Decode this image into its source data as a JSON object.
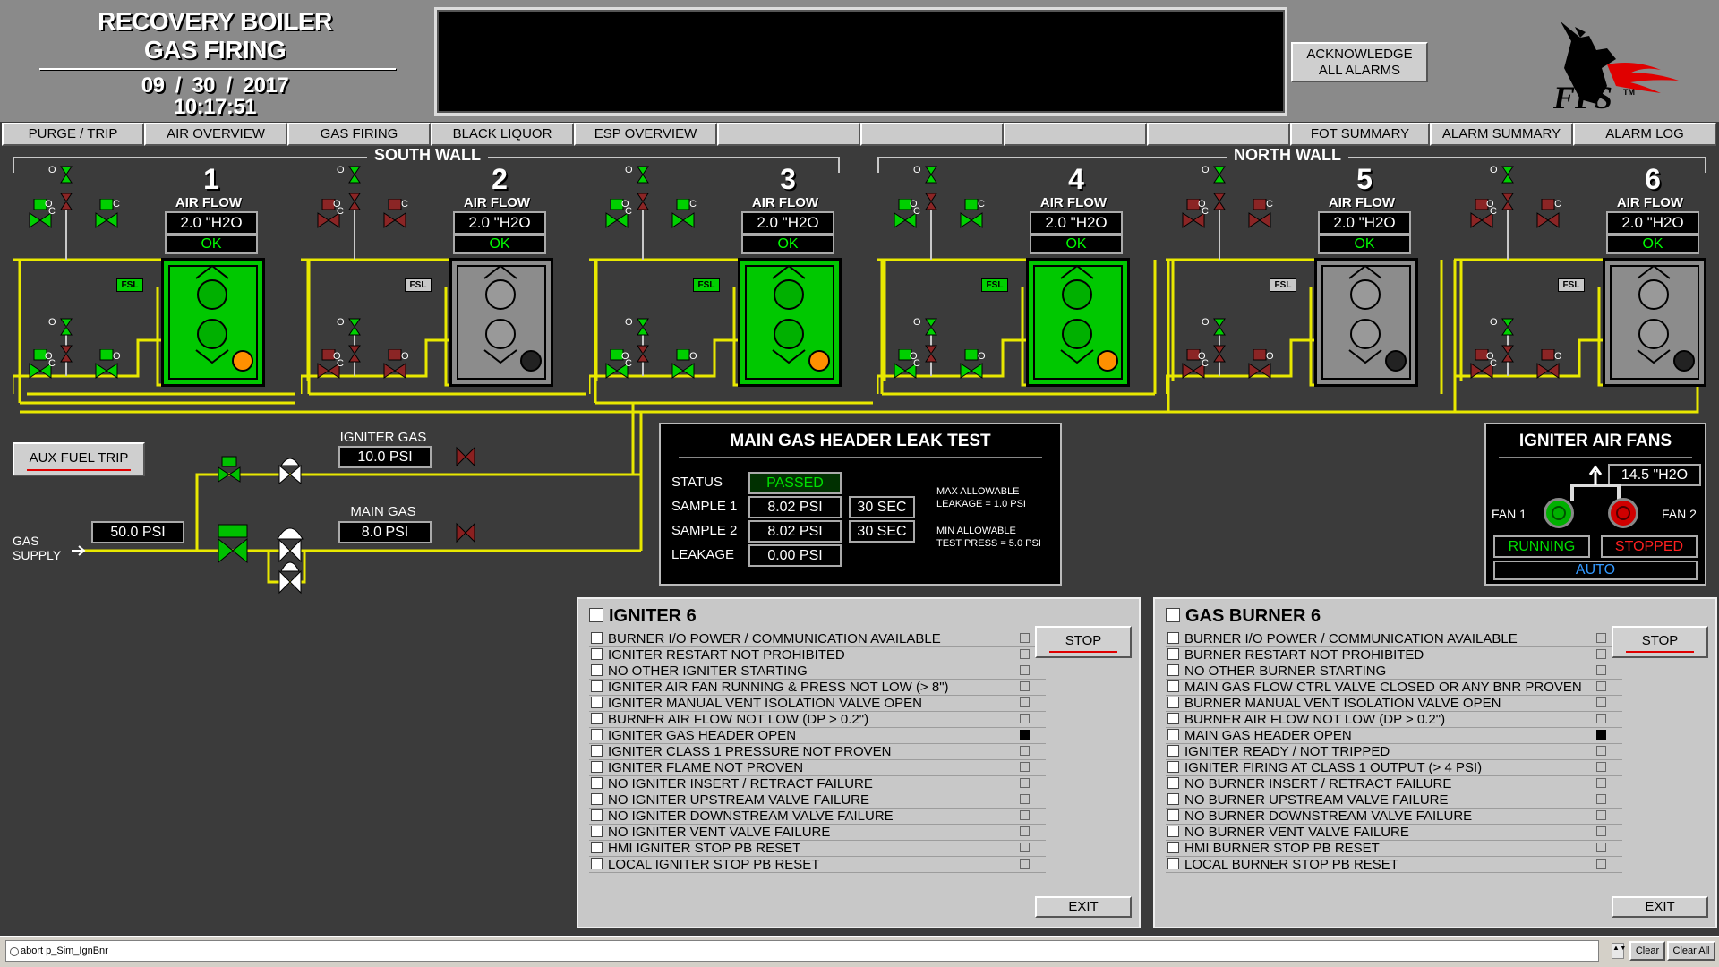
{
  "header": {
    "title_line1": "RECOVERY BOILER",
    "title_line2": "GAS FIRING",
    "date": "09  /  30  /  2017",
    "time": "10:17:51",
    "ack_label_1": "ACKNOWLEDGE",
    "ack_label_2": "ALL ALARMS",
    "logo_text": "FPS",
    "logo_tm": "TM"
  },
  "nav": {
    "purge_trip": "PURGE / TRIP",
    "air_overview": "AIR OVERVIEW",
    "gas_firing": "GAS FIRING",
    "black_liquor": "BLACK LIQUOR",
    "esp_overview": "ESP OVERVIEW",
    "fot_summary": "FOT SUMMARY",
    "alarm_summary": "ALARM SUMMARY",
    "alarm_log": "ALARM LOG"
  },
  "walls": {
    "south": "SOUTH WALL",
    "north": "NORTH WALL"
  },
  "burners": [
    {
      "num": "1",
      "air_label": "AIR FLOW",
      "air_value": "2.0 \"H2O",
      "status": "OK",
      "state": "running"
    },
    {
      "num": "2",
      "air_label": "AIR FLOW",
      "air_value": "2.0 \"H2O",
      "status": "OK",
      "state": "stopped"
    },
    {
      "num": "3",
      "air_label": "AIR FLOW",
      "air_value": "2.0 \"H2O",
      "status": "OK",
      "state": "running"
    },
    {
      "num": "4",
      "air_label": "AIR FLOW",
      "air_value": "2.0 \"H2O",
      "status": "OK",
      "state": "running"
    },
    {
      "num": "5",
      "air_label": "AIR FLOW",
      "air_value": "2.0 \"H2O",
      "status": "OK",
      "state": "stopped"
    },
    {
      "num": "6",
      "air_label": "AIR FLOW",
      "air_value": "2.0 \"H2O",
      "status": "OK",
      "state": "stopped"
    }
  ],
  "valve_labels": {
    "open": "O",
    "closed": "C",
    "fsl": "FSL"
  },
  "gas_supply": {
    "aux_fuel_trip": "AUX FUEL TRIP",
    "supply_label_1": "GAS",
    "supply_label_2": "SUPPLY",
    "supply_psi": "50.0 PSI",
    "igniter_gas_label": "IGNITER GAS",
    "igniter_gas_psi": "10.0 PSI",
    "main_gas_label": "MAIN GAS",
    "main_gas_psi": "8.0 PSI"
  },
  "leak_test": {
    "title": "MAIN GAS HEADER LEAK TEST",
    "status_label": "STATUS",
    "status_value": "PASSED",
    "sample1_label": "SAMPLE 1",
    "sample1_value": "8.02 PSI",
    "sample1_time": "30 SEC",
    "sample2_label": "SAMPLE 2",
    "sample2_value": "8.02 PSI",
    "sample2_time": "30 SEC",
    "leakage_label": "LEAKAGE",
    "leakage_value": "0.00 PSI",
    "note1_a": "MAX ALLOWABLE",
    "note1_b": "LEAKAGE = 1.0 PSI",
    "note2_a": "MIN ALLOWABLE",
    "note2_b": "TEST PRESS = 5.0 PSI"
  },
  "igniter_fans": {
    "title": "IGNITER AIR FANS",
    "pressure": "14.5 \"H2O",
    "fan1_label": "FAN 1",
    "fan2_label": "FAN 2",
    "fan1_status": "RUNNING",
    "fan2_status": "STOPPED",
    "mode": "AUTO"
  },
  "igniter_panel": {
    "title": "IGNITER 6",
    "stop": "STOP",
    "exit": "EXIT",
    "items": [
      {
        "text": "BURNER I/O POWER / COMMUNICATION AVAILABLE",
        "on": false
      },
      {
        "text": "IGNITER RESTART NOT PROHIBITED",
        "on": false
      },
      {
        "text": "NO OTHER IGNITER STARTING",
        "on": false
      },
      {
        "text": "IGNITER AIR FAN RUNNING & PRESS NOT LOW (> 8\")",
        "on": false
      },
      {
        "text": "IGNITER MANUAL VENT ISOLATION VALVE OPEN",
        "on": false
      },
      {
        "text": "BURNER AIR FLOW NOT LOW (DP > 0.2\")",
        "on": false
      },
      {
        "text": "IGNITER GAS HEADER OPEN",
        "on": true
      },
      {
        "text": "IGNITER CLASS 1 PRESSURE NOT PROVEN",
        "on": false
      },
      {
        "text": "IGNITER FLAME NOT PROVEN",
        "on": false
      },
      {
        "text": "NO IGNITER INSERT / RETRACT FAILURE",
        "on": false
      },
      {
        "text": "NO IGNITER UPSTREAM VALVE FAILURE",
        "on": false
      },
      {
        "text": "NO IGNITER DOWNSTREAM VALVE FAILURE",
        "on": false
      },
      {
        "text": "NO IGNITER VENT VALVE FAILURE",
        "on": false
      },
      {
        "text": "HMI IGNITER STOP PB RESET",
        "on": false
      },
      {
        "text": "LOCAL IGNITER STOP PB RESET",
        "on": false
      }
    ]
  },
  "burner_panel": {
    "title": "GAS BURNER 6",
    "stop": "STOP",
    "exit": "EXIT",
    "items": [
      {
        "text": "BURNER I/O POWER / COMMUNICATION AVAILABLE",
        "on": false
      },
      {
        "text": "BURNER RESTART NOT PROHIBITED",
        "on": false
      },
      {
        "text": "NO OTHER BURNER STARTING",
        "on": false
      },
      {
        "text": "MAIN GAS FLOW CTRL VALVE CLOSED OR ANY BNR PROVEN",
        "on": false
      },
      {
        "text": "BURNER MANUAL VENT ISOLATION VALVE OPEN",
        "on": false
      },
      {
        "text": "BURNER AIR FLOW NOT LOW (DP > 0.2\")",
        "on": false
      },
      {
        "text": "MAIN GAS HEADER OPEN",
        "on": true
      },
      {
        "text": "IGNITER READY / NOT TRIPPED",
        "on": false
      },
      {
        "text": "IGNITER FIRING AT CLASS 1 OUTPUT (> 4 PSI)",
        "on": false
      },
      {
        "text": "NO BURNER INSERT / RETRACT FAILURE",
        "on": false
      },
      {
        "text": "NO BURNER UPSTREAM VALVE FAILURE",
        "on": false
      },
      {
        "text": "NO BURNER DOWNSTREAM VALVE FAILURE",
        "on": false
      },
      {
        "text": "NO BURNER VENT VALVE FAILURE",
        "on": false
      },
      {
        "text": "HMI BURNER STOP PB RESET",
        "on": false
      },
      {
        "text": "LOCAL BURNER STOP PB RESET",
        "on": false
      }
    ]
  },
  "status_bar": {
    "command": "abort p_Sim_IgnBnr",
    "clear": "Clear",
    "clear_all": "Clear All"
  },
  "colors": {
    "green": "#00d000",
    "gray_burner": "#8c8c8c",
    "pipe": "#e8e800",
    "red_valve": "#8b2020"
  }
}
